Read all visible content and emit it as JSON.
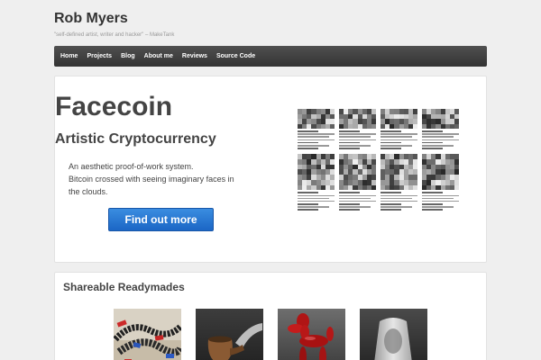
{
  "site": {
    "title": "Rob Myers",
    "tagline": "\"self-defined artist, writer and hacker\" – MakeTank"
  },
  "nav": {
    "items": [
      "Home",
      "Projects",
      "Blog",
      "About me",
      "Reviews",
      "Source Code"
    ]
  },
  "hero": {
    "title": "Facecoin",
    "subtitle": "Artistic Cryptocurrency",
    "desc_line1": "An aesthetic proof-of-work system.",
    "desc_line2": "Bitcoin crossed with seeing imaginary faces in",
    "desc_line3": "the clouds.",
    "button_label": "Find out more"
  },
  "readymades": {
    "title": "Shareable Readymades",
    "items": [
      "bicycle-chain-sculpture",
      "pipe-sculpture",
      "balloon-dog-sculpture",
      "fountain-urinal-sculpture"
    ]
  },
  "colors": {
    "button": "#2a78d6",
    "nav": "#3d3d3d"
  }
}
